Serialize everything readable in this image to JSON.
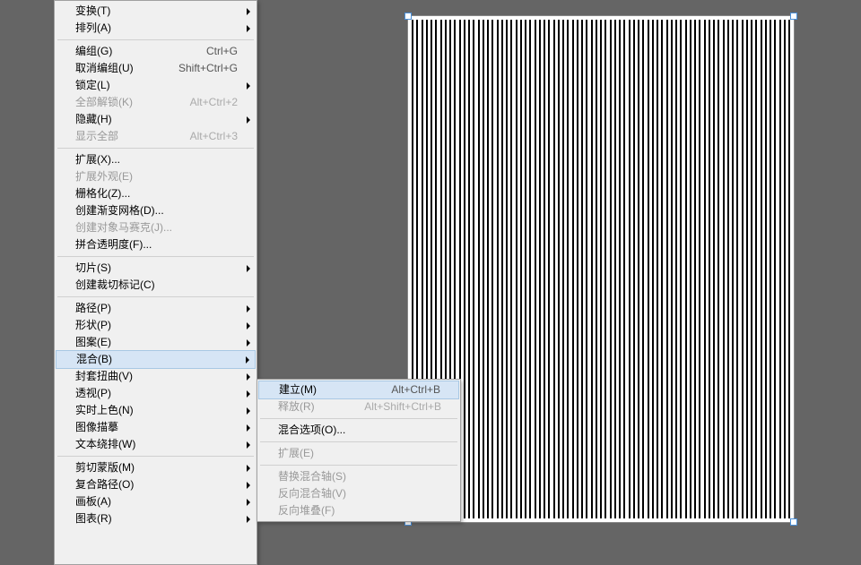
{
  "main_menu": [
    {
      "type": "item",
      "label": "变换(T)",
      "enabled": true,
      "submenu": true
    },
    {
      "type": "item",
      "label": "排列(A)",
      "enabled": true,
      "submenu": true
    },
    {
      "type": "sep"
    },
    {
      "type": "item",
      "label": "编组(G)",
      "enabled": true,
      "shortcut": "Ctrl+G"
    },
    {
      "type": "item",
      "label": "取消编组(U)",
      "enabled": true,
      "shortcut": "Shift+Ctrl+G"
    },
    {
      "type": "item",
      "label": "锁定(L)",
      "enabled": true,
      "submenu": true
    },
    {
      "type": "item",
      "label": "全部解锁(K)",
      "enabled": false,
      "shortcut": "Alt+Ctrl+2"
    },
    {
      "type": "item",
      "label": "隐藏(H)",
      "enabled": true,
      "submenu": true
    },
    {
      "type": "item",
      "label": "显示全部",
      "enabled": false,
      "shortcut": "Alt+Ctrl+3"
    },
    {
      "type": "sep"
    },
    {
      "type": "item",
      "label": "扩展(X)...",
      "enabled": true
    },
    {
      "type": "item",
      "label": "扩展外观(E)",
      "enabled": false
    },
    {
      "type": "item",
      "label": "栅格化(Z)...",
      "enabled": true
    },
    {
      "type": "item",
      "label": "创建渐变网格(D)...",
      "enabled": true
    },
    {
      "type": "item",
      "label": "创建对象马赛克(J)...",
      "enabled": false
    },
    {
      "type": "item",
      "label": "拼合透明度(F)...",
      "enabled": true
    },
    {
      "type": "sep"
    },
    {
      "type": "item",
      "label": "切片(S)",
      "enabled": true,
      "submenu": true
    },
    {
      "type": "item",
      "label": "创建裁切标记(C)",
      "enabled": true
    },
    {
      "type": "sep"
    },
    {
      "type": "item",
      "label": "路径(P)",
      "enabled": true,
      "submenu": true
    },
    {
      "type": "item",
      "label": "形状(P)",
      "enabled": true,
      "submenu": true
    },
    {
      "type": "item",
      "label": "图案(E)",
      "enabled": true,
      "submenu": true
    },
    {
      "type": "item",
      "label": "混合(B)",
      "enabled": true,
      "submenu": true,
      "highlight": true
    },
    {
      "type": "item",
      "label": "封套扭曲(V)",
      "enabled": true,
      "submenu": true
    },
    {
      "type": "item",
      "label": "透视(P)",
      "enabled": true,
      "submenu": true
    },
    {
      "type": "item",
      "label": "实时上色(N)",
      "enabled": true,
      "submenu": true
    },
    {
      "type": "item",
      "label": "图像描摹",
      "enabled": true,
      "submenu": true
    },
    {
      "type": "item",
      "label": "文本绕排(W)",
      "enabled": true,
      "submenu": true
    },
    {
      "type": "sep"
    },
    {
      "type": "item",
      "label": "剪切蒙版(M)",
      "enabled": true,
      "submenu": true
    },
    {
      "type": "item",
      "label": "复合路径(O)",
      "enabled": true,
      "submenu": true
    },
    {
      "type": "item",
      "label": "画板(A)",
      "enabled": true,
      "submenu": true
    },
    {
      "type": "item",
      "label": "图表(R)",
      "enabled": true,
      "submenu": true
    }
  ],
  "sub_menu": [
    {
      "type": "item",
      "label": "建立(M)",
      "enabled": true,
      "shortcut": "Alt+Ctrl+B",
      "highlight": true
    },
    {
      "type": "item",
      "label": "释放(R)",
      "enabled": false,
      "shortcut": "Alt+Shift+Ctrl+B"
    },
    {
      "type": "sep"
    },
    {
      "type": "item",
      "label": "混合选项(O)...",
      "enabled": true
    },
    {
      "type": "sep"
    },
    {
      "type": "item",
      "label": "扩展(E)",
      "enabled": false
    },
    {
      "type": "sep"
    },
    {
      "type": "item",
      "label": "替换混合轴(S)",
      "enabled": false
    },
    {
      "type": "item",
      "label": "反向混合轴(V)",
      "enabled": false
    },
    {
      "type": "item",
      "label": "反向堆叠(F)",
      "enabled": false
    }
  ],
  "stripe_count": 81
}
